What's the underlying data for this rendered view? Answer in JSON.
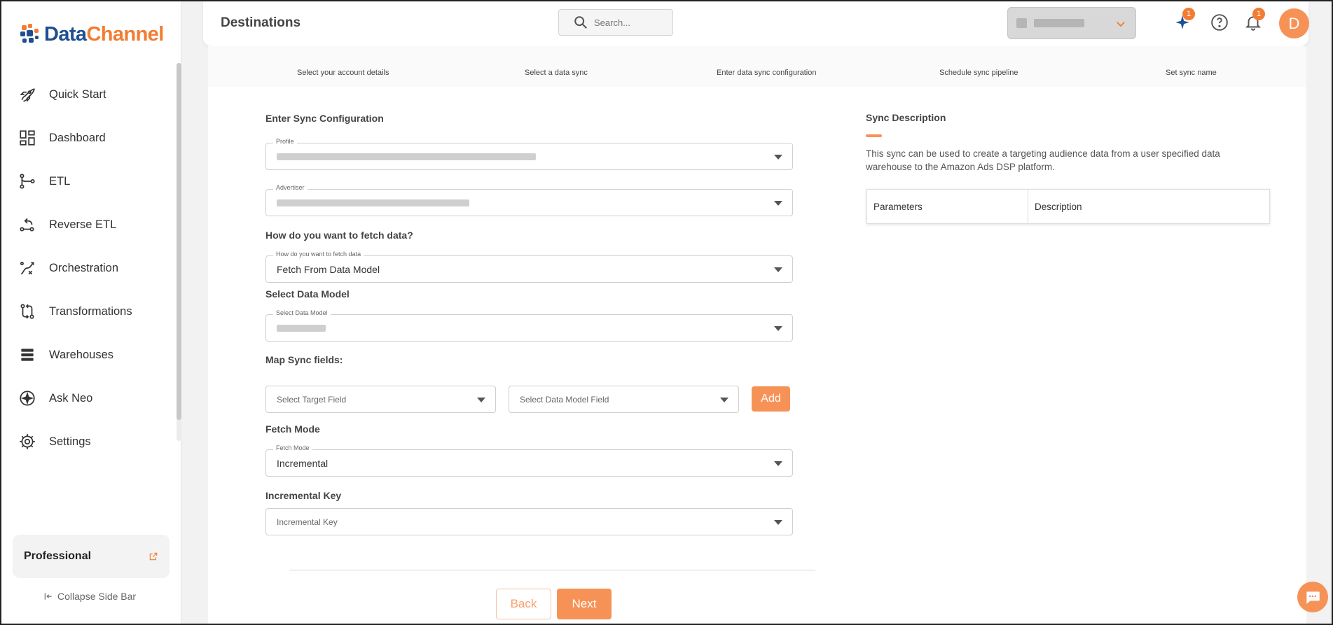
{
  "brand": {
    "name_a": "Data",
    "name_b": "Channel",
    "color_primary": "#1f4f8f",
    "color_accent": "#f37c32"
  },
  "sidebar": {
    "items": [
      {
        "label": "Quick Start",
        "icon": "rocket-icon"
      },
      {
        "label": "Dashboard",
        "icon": "dashboard-icon"
      },
      {
        "label": "ETL",
        "icon": "etl-icon"
      },
      {
        "label": "Reverse ETL",
        "icon": "reverse-etl-icon"
      },
      {
        "label": "Orchestration",
        "icon": "orchestration-icon"
      },
      {
        "label": "Transformations",
        "icon": "transformations-icon"
      },
      {
        "label": "Warehouses",
        "icon": "warehouses-icon"
      },
      {
        "label": "Ask Neo",
        "icon": "sparkle-icon"
      },
      {
        "label": "Settings",
        "icon": "gear-icon"
      }
    ],
    "plan": "Professional",
    "collapse_label": "Collapse Side Bar"
  },
  "header": {
    "title": "Destinations",
    "search_placeholder": "Search...",
    "sparkle_badge": "1",
    "notif_badge": "1",
    "avatar_letter": "D"
  },
  "steps": [
    "Select your account details",
    "Select a data sync",
    "Enter data sync configuration",
    "Schedule sync pipeline",
    "Set sync name"
  ],
  "form": {
    "section_title": "Enter Sync Configuration",
    "profile_legend": "Profile",
    "advertiser_legend": "Advertiser",
    "fetch_question": "How do you want to fetch data?",
    "fetch_legend": "How do you want to fetch data",
    "fetch_value": "Fetch From Data Model",
    "data_model_title": "Select Data Model",
    "data_model_legend": "Select Data Model",
    "map_title": "Map Sync fields:",
    "target_field_placeholder": "Select Target Field",
    "data_model_field_placeholder": "Select Data Model Field",
    "add_label": "Add",
    "fetch_mode_title": "Fetch Mode",
    "fetch_mode_legend": "Fetch Mode",
    "fetch_mode_value": "Incremental",
    "incremental_key_title": "Incremental Key",
    "incremental_key_placeholder": "Incremental Key",
    "back_label": "Back",
    "next_label": "Next"
  },
  "description": {
    "title": "Sync Description",
    "text": "This sync can be used to create a targeting audience data from a user specified data warehouse to the Amazon Ads DSP platform.",
    "col_parameters": "Parameters",
    "col_description": "Description"
  }
}
